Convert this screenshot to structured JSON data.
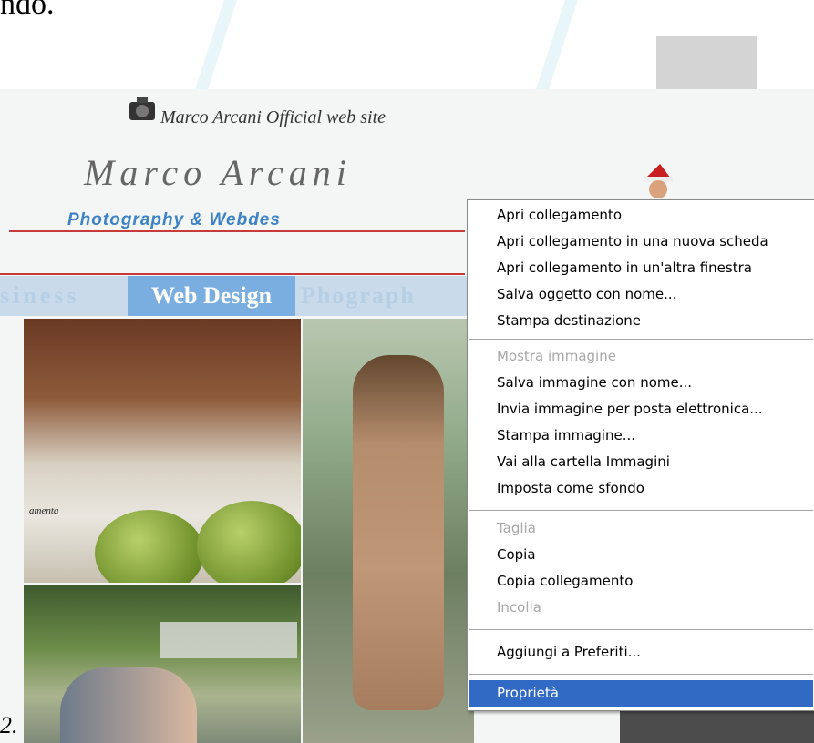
{
  "doc": {
    "partial_text": "ndo.",
    "partial_label": "2."
  },
  "site": {
    "title": "Marco Arcani Official web site",
    "logo_script": "Marco Arcani",
    "logo_subtitle": "Photography & Webdes",
    "nav": {
      "business": "siness",
      "webdesign": "Web Design",
      "photography": "Phograph"
    },
    "photo_caption": "amenta"
  },
  "context_menu": {
    "items": [
      {
        "label": "Apri collegamento",
        "state": "enabled"
      },
      {
        "label": "Apri collegamento in una nuova scheda",
        "state": "enabled"
      },
      {
        "label": "Apri collegamento in un'altra finestra",
        "state": "enabled"
      },
      {
        "label": "Salva oggetto con nome...",
        "state": "enabled"
      },
      {
        "label": "Stampa destinazione",
        "state": "enabled"
      },
      {
        "label": "Mostra immagine",
        "state": "disabled"
      },
      {
        "label": "Salva immagine con nome...",
        "state": "enabled"
      },
      {
        "label": "Invia immagine per posta elettronica...",
        "state": "enabled"
      },
      {
        "label": "Stampa immagine...",
        "state": "enabled"
      },
      {
        "label": "Vai alla cartella Immagini",
        "state": "enabled"
      },
      {
        "label": "Imposta come sfondo",
        "state": "enabled"
      },
      {
        "label": "Taglia",
        "state": "disabled"
      },
      {
        "label": "Copia",
        "state": "enabled"
      },
      {
        "label": "Copia collegamento",
        "state": "enabled"
      },
      {
        "label": "Incolla",
        "state": "disabled"
      },
      {
        "label": "Aggiungi a Preferiti...",
        "state": "enabled"
      },
      {
        "label": "Proprietà",
        "state": "selected"
      }
    ]
  },
  "colors": {
    "menu_highlight": "#316ac5",
    "nav_active": "#7aaee0",
    "accent_red": "#c83a3a",
    "logo_blue": "#3c82c4"
  }
}
